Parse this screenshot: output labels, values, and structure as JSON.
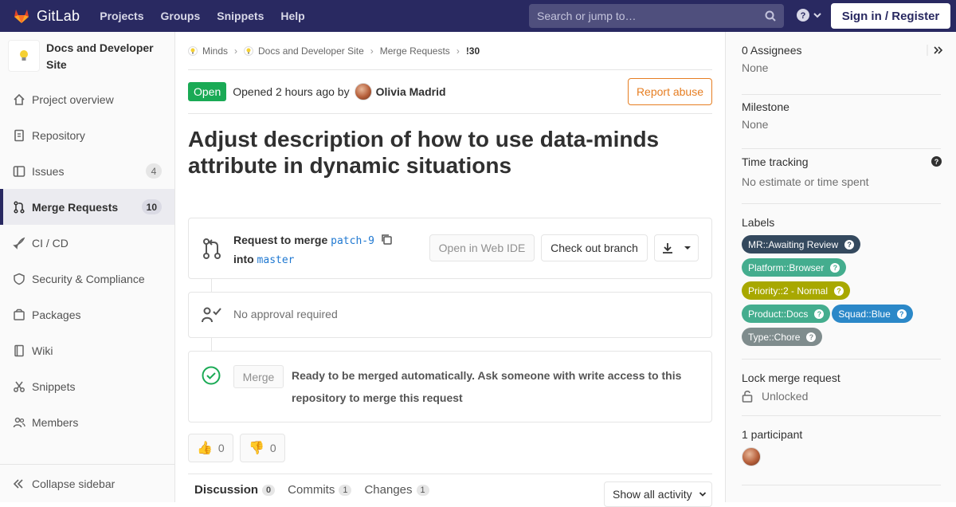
{
  "topbar": {
    "brand": "GitLab",
    "links": [
      "Projects",
      "Groups",
      "Snippets",
      "Help"
    ],
    "search_placeholder": "Search or jump to…",
    "signin": "Sign in / Register"
  },
  "sidebar": {
    "project_name": "Docs and Developer Site",
    "items": [
      {
        "label": "Project overview",
        "icon": "home-icon"
      },
      {
        "label": "Repository",
        "icon": "doc-icon"
      },
      {
        "label": "Issues",
        "icon": "issues-icon",
        "count": "4"
      },
      {
        "label": "Merge Requests",
        "icon": "merge-request-icon",
        "count": "10",
        "active": true
      },
      {
        "label": "CI / CD",
        "icon": "rocket-icon"
      },
      {
        "label": "Security & Compliance",
        "icon": "shield-icon"
      },
      {
        "label": "Packages",
        "icon": "package-icon"
      },
      {
        "label": "Wiki",
        "icon": "book-icon"
      },
      {
        "label": "Snippets",
        "icon": "scissors-icon"
      },
      {
        "label": "Members",
        "icon": "users-icon"
      }
    ],
    "collapse": "Collapse sidebar"
  },
  "breadcrumb": {
    "items": [
      "Minds",
      "Docs and Developer Site",
      "Merge Requests",
      "!30"
    ]
  },
  "mr": {
    "status": "Open",
    "opened_text": "Opened 2 hours ago by",
    "author": "Olivia Madrid",
    "report": "Report abuse",
    "title": "Adjust description of how to use data-minds attribute in dynamic situations",
    "request_to_merge": "Request to merge",
    "source_branch": "patch-9",
    "into": "into",
    "target_branch": "master",
    "open_web_ide": "Open in Web IDE",
    "check_out": "Check out branch",
    "approval": "No approval required",
    "merge_button": "Merge",
    "ready_text": "Ready to be merged automatically. Ask someone with write access to this repository to merge this request",
    "thumbs_up": "0",
    "thumbs_down": "0"
  },
  "tabs": [
    {
      "label": "Discussion",
      "count": "0",
      "active": true
    },
    {
      "label": "Commits",
      "count": "1"
    },
    {
      "label": "Changes",
      "count": "1"
    }
  ],
  "activity": "Show all activity",
  "right_sidebar": {
    "assignees_title": "0 Assignees",
    "assignees_value": "None",
    "milestone_title": "Milestone",
    "milestone_value": "None",
    "time_title": "Time tracking",
    "time_value": "No estimate or time spent",
    "labels_title": "Labels",
    "labels": [
      {
        "text": "MR::Awaiting Review",
        "color": "#34495e"
      },
      {
        "text": "Platform::Browser",
        "color": "#44ad8e"
      },
      {
        "text": "Priority::2 - Normal",
        "color": "#a8a800"
      },
      {
        "text": "Product::Docs",
        "color": "#44ad8e"
      },
      {
        "text": "Squad::Blue",
        "color": "#2b88c8"
      },
      {
        "text": "Type::Chore",
        "color": "#7f8c8d"
      }
    ],
    "lock_title": "Lock merge request",
    "lock_value": "Unlocked",
    "participants_title": "1 participant"
  }
}
